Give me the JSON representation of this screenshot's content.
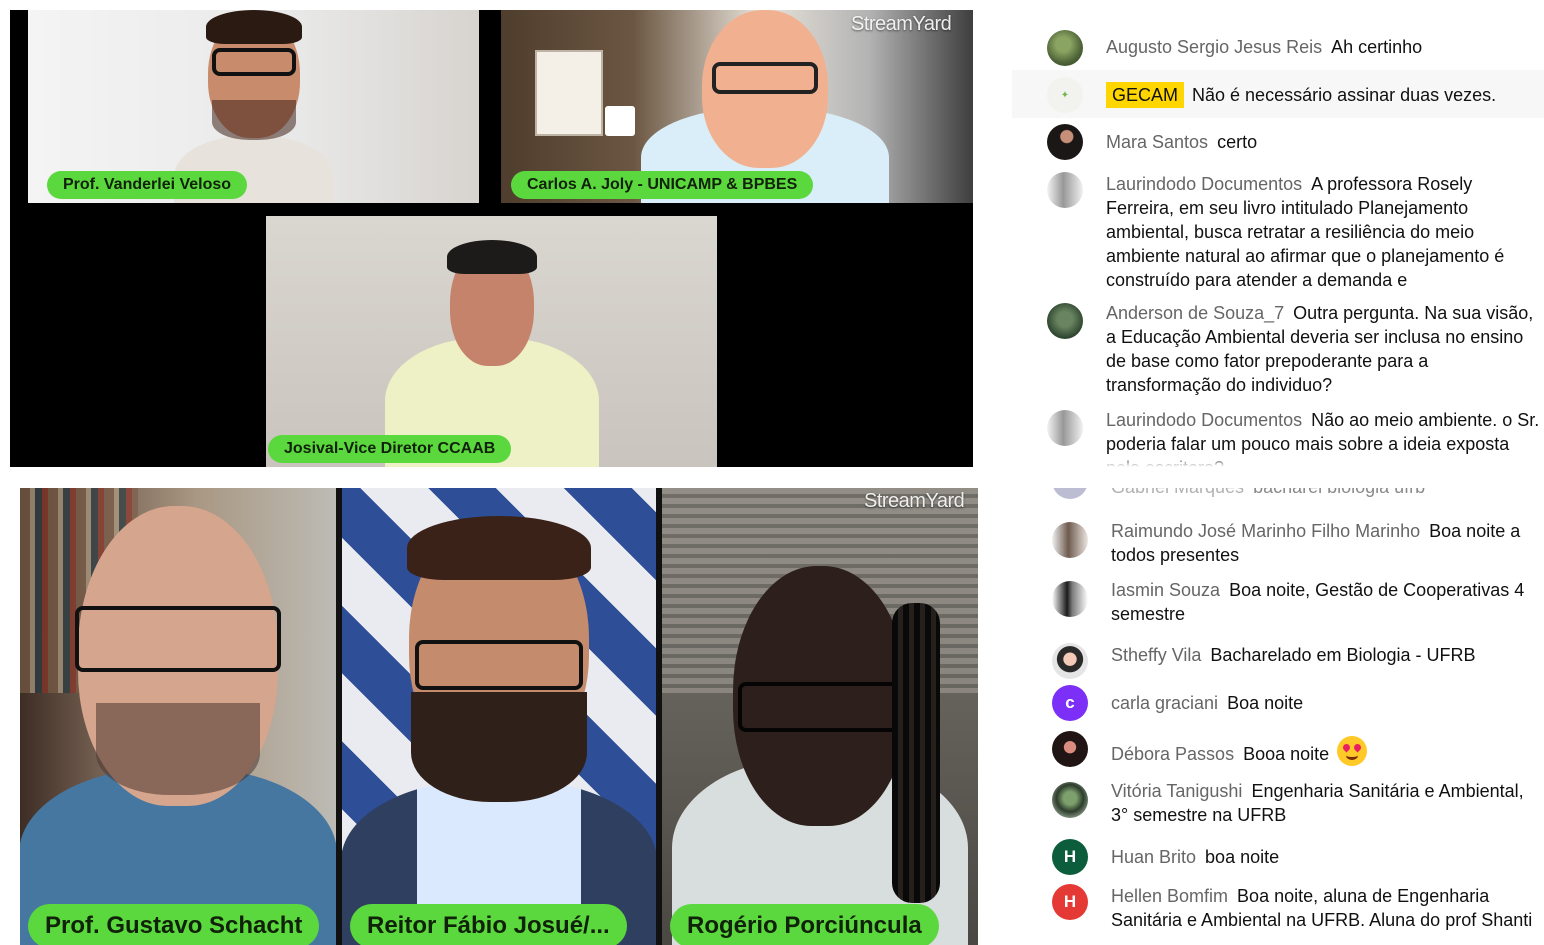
{
  "top_section": {
    "stream_logo": "StreamYard",
    "participants": [
      {
        "name": "Prof. Vanderlei Veloso"
      },
      {
        "name": "Carlos A. Joly - UNICAMP & BPBES"
      },
      {
        "name": "Josival-Vice Diretor CCAAB"
      }
    ],
    "chat": [
      {
        "author": "Augusto Sergio Jesus Reis",
        "message": "Ah certinho"
      },
      {
        "author": "GECAM",
        "message": "Não é necessário assinar duas vezes."
      },
      {
        "author": "Mara Santos",
        "message": "certo"
      },
      {
        "author": "Laurindodo Documentos",
        "message": "A professora Rosely Ferreira, em seu livro intitulado Planejamento ambiental, busca retratar a resiliência do meio ambiente natural ao afirmar que o planejamento é construído para atender a demanda e"
      },
      {
        "author": "Anderson de Souza_7",
        "message": "Outra pergunta. Na sua visão, a Educação Ambiental deveria ser inclusa no ensino de base como fator prepoderante para a transformação do individuo?"
      },
      {
        "author": "Laurindodo Documentos",
        "message": "Não ao meio ambiente. o Sr. poderia falar um pouco mais sobre a ideia exposta pela escritora?"
      }
    ]
  },
  "bottom_section": {
    "stream_logo": "StreamYard",
    "participants": [
      {
        "name": "Prof. Gustavo Schacht"
      },
      {
        "name": "Reitor Fábio Josué/..."
      },
      {
        "name": "Rogério Porciúncula"
      }
    ],
    "chat": [
      {
        "author": "Gabriel Marques",
        "message": "bacharel biologia ufrb"
      },
      {
        "author": "Raimundo José Marinho Filho Marinho",
        "message": "Boa noite a todos presentes"
      },
      {
        "author": "Iasmin Souza",
        "message": "Boa noite, Gestão de Cooperativas 4 semestre"
      },
      {
        "author": "Stheffy Vila",
        "message": "Bacharelado em Biologia - UFRB"
      },
      {
        "author": "carla graciani",
        "message": "Boa noite",
        "avatar_letter": "c",
        "avatar_color": "#7b2ff7"
      },
      {
        "author": "Débora Passos",
        "message": "Booa noite"
      },
      {
        "author": "Vitória Tanigushi",
        "message": "Engenharia Sanitária e Ambiental, 3° semestre na UFRB"
      },
      {
        "author": "Huan Brito",
        "message": "boa noite",
        "avatar_letter": "H",
        "avatar_color": "#0b5d3b"
      },
      {
        "author": "Hellen Bomfim",
        "message": "Boa noite, aluna de Engenharia Sanitária e Ambiental na UFRB. Aluna do prof Shanti",
        "avatar_letter": "H",
        "avatar_color": "#e53935"
      }
    ]
  },
  "colors": {
    "nameplate": "#5bd83d",
    "highlight": "#ffd600",
    "author_text": "#666666"
  },
  "icons": {
    "emoji": "star-struck-emoji-icon"
  }
}
